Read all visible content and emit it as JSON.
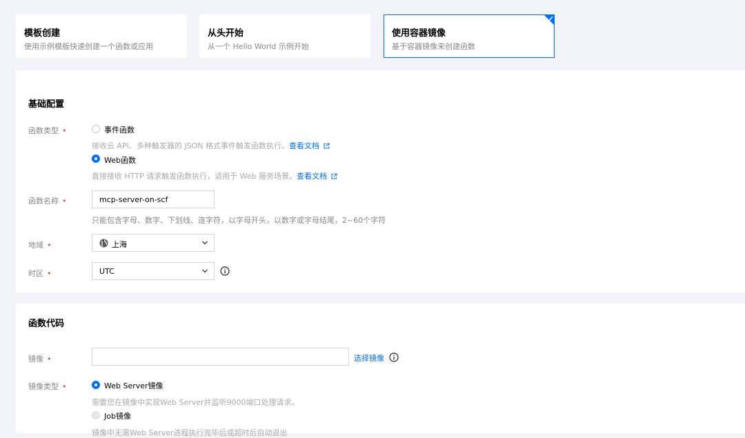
{
  "templates": [
    {
      "title": "模板创建",
      "desc": "使用示例模版快速创建一个函数或应用",
      "selected": false
    },
    {
      "title": "从头开始",
      "desc": "从一个 Hello World 示例开始",
      "selected": false
    },
    {
      "title": "使用容器镜像",
      "desc": "基于容器镜像来创建函数",
      "selected": true
    }
  ],
  "basic": {
    "title": "基础配置",
    "function_type": {
      "label": "函数类型",
      "options": [
        {
          "label": "事件函数",
          "hint": "接收云 API、多种触发器的 JSON 格式事件触发函数执行。",
          "link": "查看文档",
          "checked": false
        },
        {
          "label": "Web函数",
          "hint": "直接接收 HTTP 请求触发函数执行，适用于 Web 服务场景。",
          "link": "查看文档",
          "checked": true
        }
      ]
    },
    "function_name": {
      "label": "函数名称",
      "value": "mcp-server-on-scf",
      "hint": "只能包含字母、数字、下划线、连字符，以字母开头，以数字或字母结尾，2~60个字符"
    },
    "region": {
      "label": "地域",
      "value": "上海",
      "icon": "globe-icon"
    },
    "timezone": {
      "label": "时区",
      "value": "UTC",
      "icon": "info-icon"
    }
  },
  "code": {
    "title": "函数代码",
    "image": {
      "label": "镜像",
      "value": "",
      "link": "选择镜像",
      "icon": "info-icon"
    },
    "image_type": {
      "label": "镜像类型",
      "options": [
        {
          "label": "Web Server镜像",
          "hint": "需要您在镜像中实现Web Server并监听9000端口处理请求。",
          "checked": true
        },
        {
          "label": "Job镜像",
          "hint": "镜像中无需Web Server进程执行完毕后或超时后自动退出",
          "checked": false
        }
      ]
    }
  },
  "colors": {
    "accent": "#006eff",
    "required": "#e54545",
    "background": "#f2f3f8"
  }
}
